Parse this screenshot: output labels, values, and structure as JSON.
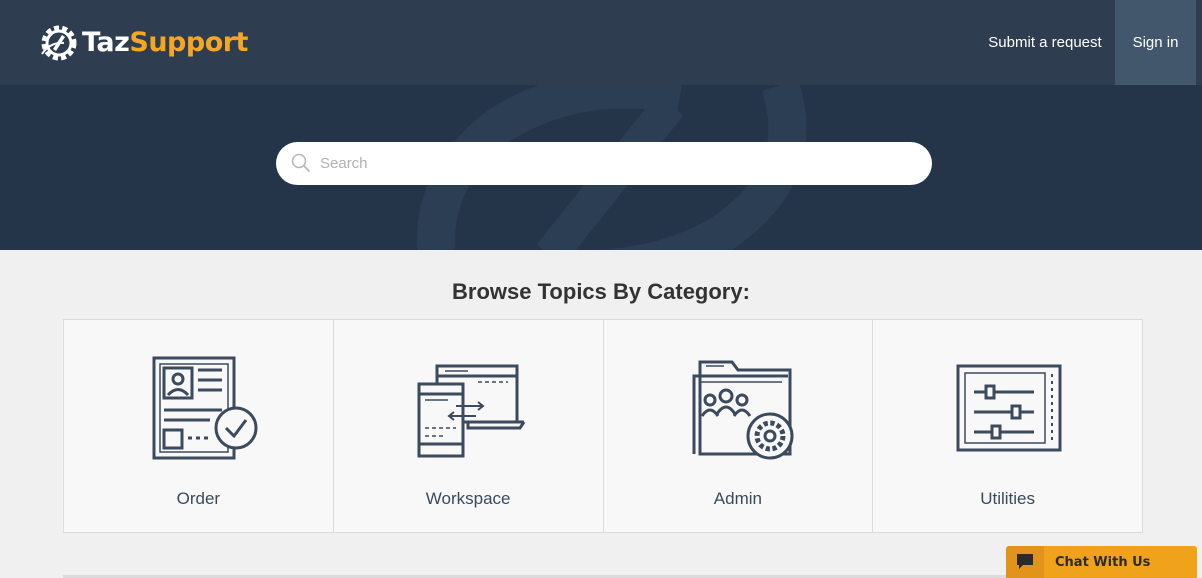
{
  "brand": {
    "name_part1": "Taz",
    "name_part2": "Support",
    "accent_color": "#f5a623",
    "header_color": "#2e3e50"
  },
  "nav": {
    "submit_request": "Submit a request",
    "sign_in": "Sign in"
  },
  "search": {
    "placeholder": "Search",
    "icon": "search-icon"
  },
  "browse": {
    "title": "Browse Topics By Category:",
    "categories": [
      {
        "label": "Order",
        "icon": "order-document-check-icon"
      },
      {
        "label": "Workspace",
        "icon": "workspace-devices-icon"
      },
      {
        "label": "Admin",
        "icon": "admin-folder-gear-icon"
      },
      {
        "label": "Utilities",
        "icon": "utilities-sliders-icon"
      }
    ]
  },
  "chat": {
    "label": "Chat With Us",
    "icon": "chat-bubble-icon"
  }
}
